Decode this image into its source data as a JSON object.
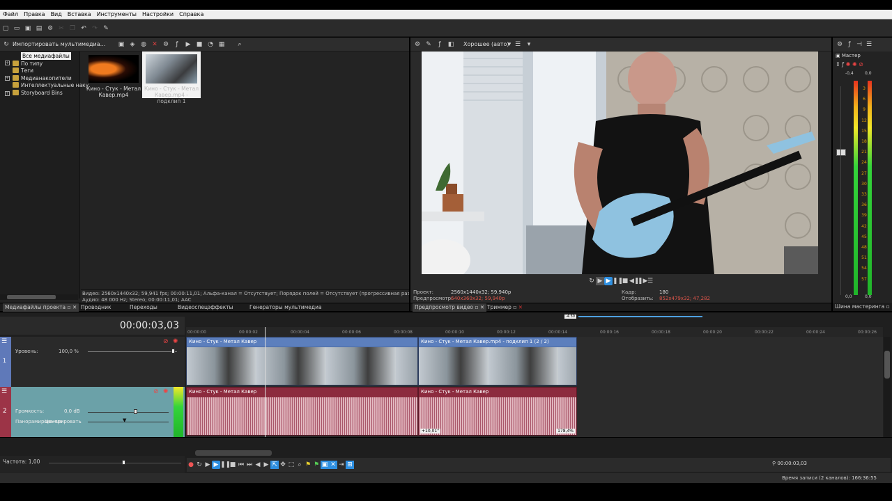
{
  "menu": [
    "Файл",
    "Правка",
    "Вид",
    "Вставка",
    "Инструменты",
    "Настройки",
    "Справка"
  ],
  "toolbar_icons": [
    "new-icon",
    "open-icon",
    "save-icon",
    "save-as-icon",
    "properties-icon",
    "undo-icon",
    "redo-icon",
    "snap-icon"
  ],
  "media": {
    "import_label": "Импортировать мультимедиа...",
    "tree": [
      "Все медиафайлы",
      "По типу",
      "Теги",
      "Медианакопители",
      "Интеллектуальные наку",
      "Storyboard Bins"
    ],
    "thumbs": [
      {
        "caption": "Кино - Стук - Метал Кавер.mp4"
      },
      {
        "caption": "Кино - Стук - Метал Кавер.mp4 - подклип 1"
      }
    ],
    "info_line1": "Видео: 2560x1440x32; 59,941 fps; 00:00:11,01; Альфа-канал = Отсутствует; Порядок полей = Отсутствует (прогрессивная развертка);",
    "info_line2": "Аудио: 48 000 Hz; Stereo; 00:00:11,01; AAC",
    "tabs": [
      "Медиафайлы проекта",
      "Проводник",
      "Переходы",
      "Видеоспецэффекты",
      "Генераторы мультимедиа"
    ]
  },
  "preview": {
    "quality": "Хорошее (авто)",
    "project_label": "Проект:",
    "project_value": "2560x1440x32; 59,940p",
    "preview_label": "Предпросмотр:",
    "preview_value": "640x360x32; 59,940p",
    "frame_label": "Кадр:",
    "frame_value": "180",
    "display_label": "Отобразить:",
    "display_value": "852x479x32; 47,282",
    "tabs": [
      "Предпросмотр видео",
      "Триммер"
    ]
  },
  "master": {
    "title": "Мастер",
    "peak_left": "-0,4",
    "peak_right": "0,0",
    "scale": [
      "3",
      "6",
      "9",
      "12",
      "15",
      "18",
      "21",
      "24",
      "27",
      "30",
      "33",
      "36",
      "39",
      "42",
      "45",
      "48",
      "51",
      "54",
      "57"
    ],
    "bottom_left": "0,0",
    "bottom_right": "0,0",
    "tab": "Шина мастеринга"
  },
  "timeline": {
    "timecode": "00:00:03,03",
    "zoom_badge": "-4.50",
    "ruler": [
      "00:00:00",
      "00:00:02",
      "00:00:04",
      "00:00:06",
      "00:00:08",
      "00:00:10",
      "00:00:12",
      "00:00:14",
      "00:00:16",
      "00:00:18",
      "00:00:20",
      "00:00:22",
      "00:00:24",
      "00:00:26"
    ],
    "video_track": {
      "level_label": "Уровень:",
      "level_value": "100,0 %",
      "clip1": "Кино - Стук - Метал Кавер",
      "clip2": "Кино - Стук - Метал Кавер.mp4 - подклип 1  (2 / 2)"
    },
    "audio_track": {
      "number": "2",
      "volume_label": "Громкость:",
      "volume_value": "0,0 dB",
      "pan_label": "Панорамирование:",
      "pan_value": "Центрировать",
      "clip1": "Кино - Стук - Метал Кавер",
      "clip2": "Кино - Стук - Метал Кавер",
      "badge_left": "+10,01\"",
      "badge_right": "178,4%"
    },
    "rate": "Частота: 1,00",
    "current_time": "00:00:03,03"
  },
  "status": {
    "record_time": "Время записи (2 каналов): 166:36:55"
  },
  "colors": {
    "accent": "#2e8fe0",
    "video_track": "#5f79b9",
    "audio_track": "#9c3447"
  }
}
